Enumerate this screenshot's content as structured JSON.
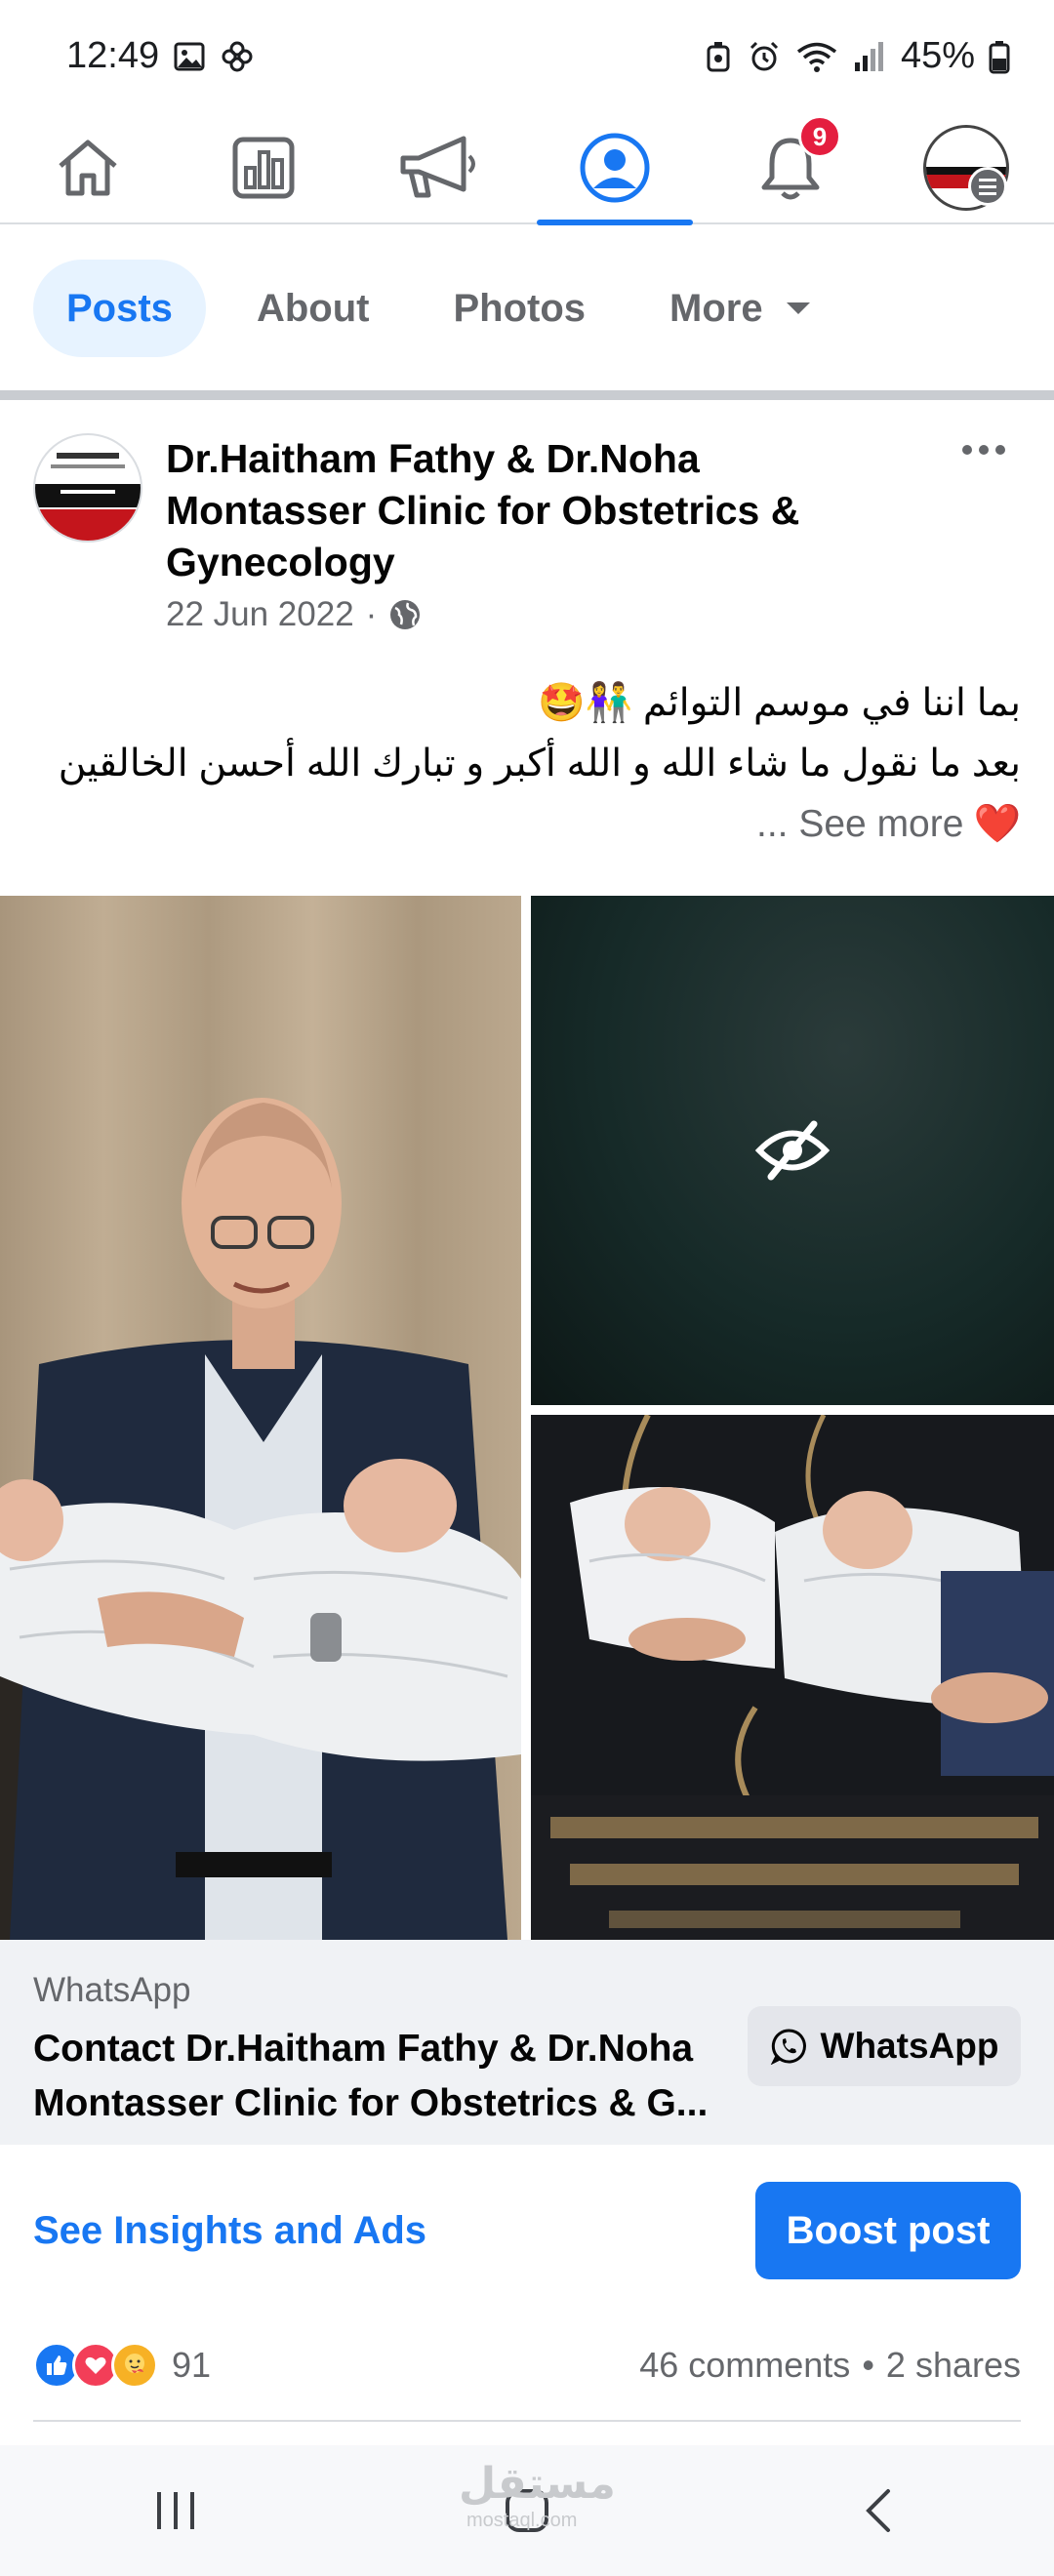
{
  "status_bar": {
    "time": "12:49",
    "battery": "45%"
  },
  "nav": {
    "notification_count": "9"
  },
  "tabs": [
    {
      "label": "Posts",
      "active": true
    },
    {
      "label": "About",
      "active": false
    },
    {
      "label": "Photos",
      "active": false
    },
    {
      "label": "More",
      "active": false
    }
  ],
  "post": {
    "author": "Dr.Haitham Fathy & Dr.Noha Montasser Clinic for Obstetrics & Gynecology",
    "date": "22 Jun 2022",
    "separator": "·",
    "text_line1": "بما اننا في موسم التوائم 👫🤩",
    "text_line2": "بعد ما نقول ما شاء الله و الله أكبر و تبارك الله أحسن الخالقين",
    "text_line3_emoji": "❤️",
    "see_more": "... See more"
  },
  "cta": {
    "label": "WhatsApp",
    "title": "Contact Dr.Haitham Fathy & Dr.Noha Montasser Clinic for Obstetrics & G...",
    "button": "WhatsApp"
  },
  "insights": {
    "link": "See Insights and Ads",
    "boost": "Boost post"
  },
  "reactions": {
    "count": "91",
    "comments": "46 comments",
    "dot": "•",
    "shares": "2 shares"
  },
  "watermark": {
    "text": "مستقل",
    "sub": "mostaql.com"
  },
  "colors": {
    "accent": "#1877f2",
    "badge": "#e41e3f",
    "secondary_text": "#65676b"
  }
}
